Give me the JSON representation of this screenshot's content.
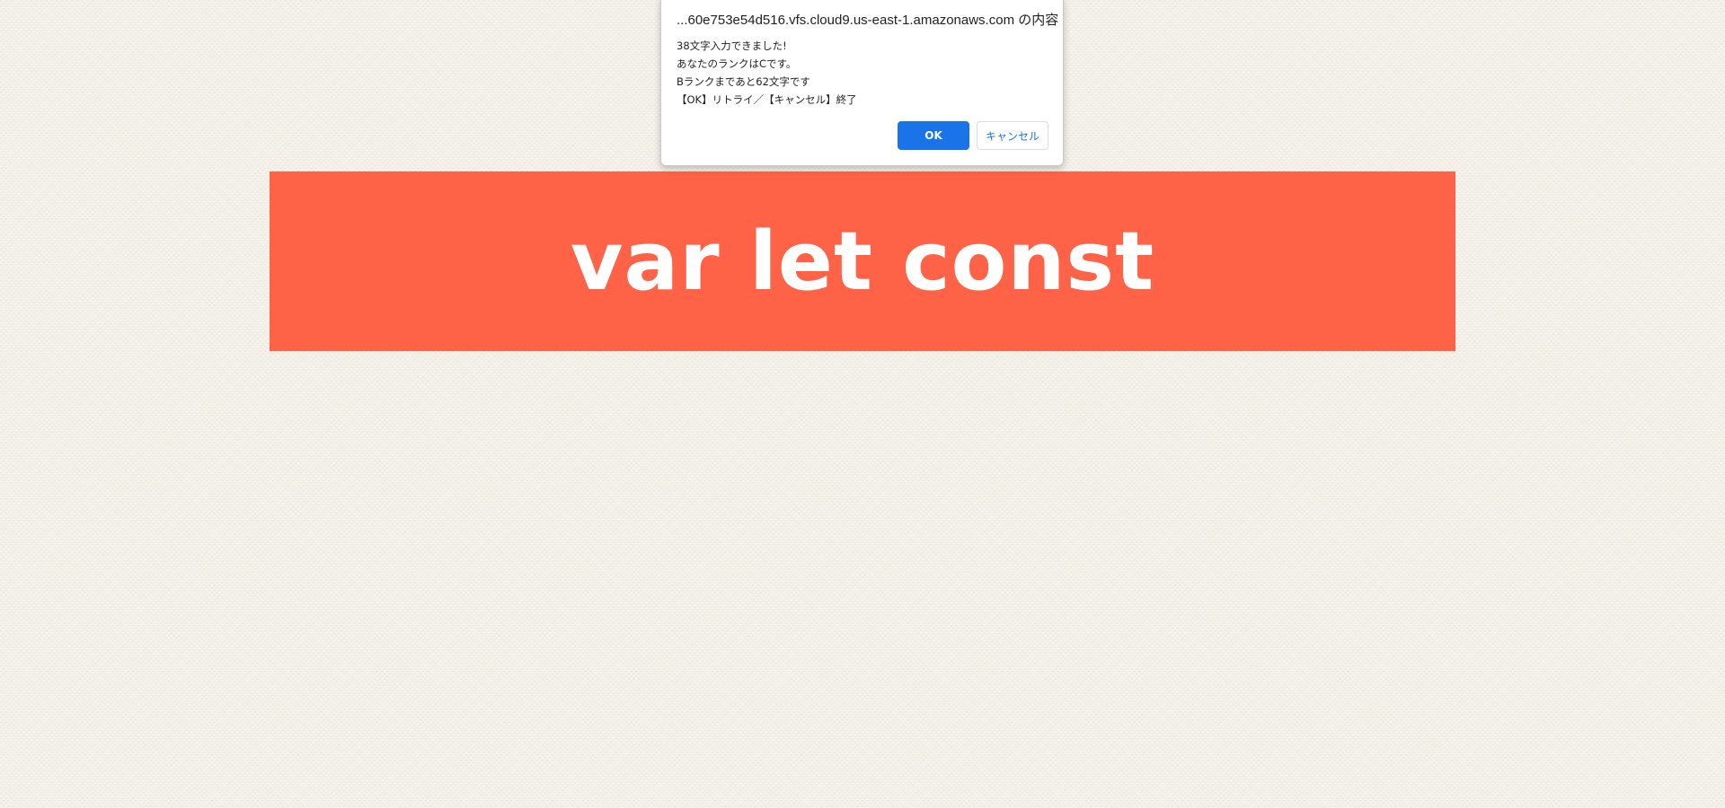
{
  "typing_game": {
    "current_word": "var let const",
    "banner_color": "#ff6347"
  },
  "alert": {
    "origin": "...60e753e54d516.vfs.cloud9.us-east-1.amazonaws.com の内容",
    "message_lines": [
      "38文字入力できました!",
      "あなたのランクはCです。",
      "Bランクまであと62文字です",
      "【OK】リトライ／【キャンセル】終了"
    ],
    "ok_label": "OK",
    "cancel_label": "キャンセル",
    "accent_color": "#1a73e8"
  }
}
